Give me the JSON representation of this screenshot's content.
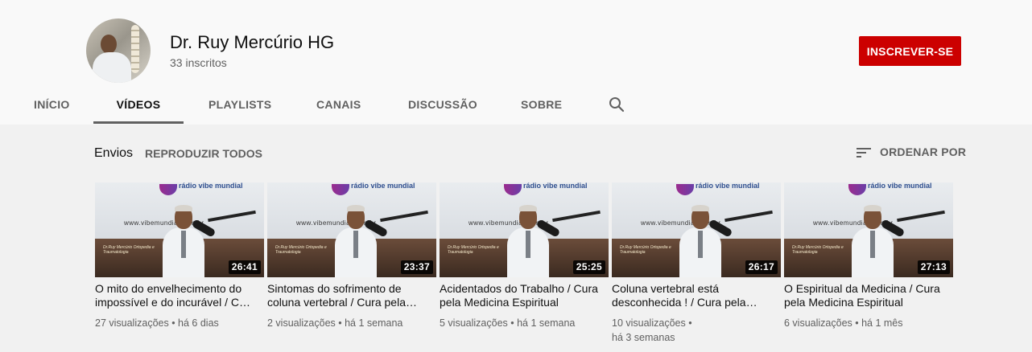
{
  "channel": {
    "name": "Dr. Ruy Mercúrio HG",
    "subscribers": "33 inscritos",
    "subscribe_label": "INSCREVER-SE",
    "subscribe_color": "#cc0000"
  },
  "tabs": [
    {
      "label": "INÍCIO",
      "active": false
    },
    {
      "label": "VÍDEOS",
      "active": true
    },
    {
      "label": "PLAYLISTS",
      "active": false
    },
    {
      "label": "CANAIS",
      "active": false
    },
    {
      "label": "DISCUSSÃO",
      "active": false
    },
    {
      "label": "SOBRE",
      "active": false
    }
  ],
  "search_icon": "search-icon",
  "shelf": {
    "title": "Envios",
    "play_all": "REPRODUZIR TODOS",
    "sort_label": "ORDENAR POR",
    "sort_icon": "sort-icon"
  },
  "videos": [
    {
      "title": "O mito do envelhecimento do impossível e do incurável / Cura pela Medicina Espiritual",
      "duration": "26:41",
      "views": "27 visualizações",
      "age": "há 6 dias"
    },
    {
      "title": "Sintomas do sofrimento de coluna vertebral / Cura pela Medicina Espiritual",
      "duration": "23:37",
      "views": "2 visualizações",
      "age": "há 1 semana"
    },
    {
      "title": "Acidentados do Trabalho / Cura pela Medicina Espiritual",
      "duration": "25:25",
      "views": "5 visualizações",
      "age": "há 1 semana"
    },
    {
      "title": "Coluna vertebral está desconhecida ! / Cura pela Medicina Espiritual",
      "duration": "26:17",
      "views": "10 visualizações",
      "age": "há 3 semanas"
    },
    {
      "title": "O Espiritual da Medicina / Cura pela Medicina Espiritual",
      "duration": "27:13",
      "views": "6 visualizações",
      "age": "há 1 mês"
    }
  ],
  "thumbnail_text": {
    "brand": "rádio vibe mundial",
    "site": "www.vibemundial.com.br",
    "caption": "Dr.Ruy Mercúrio Ortopedia e Traumatologia"
  }
}
